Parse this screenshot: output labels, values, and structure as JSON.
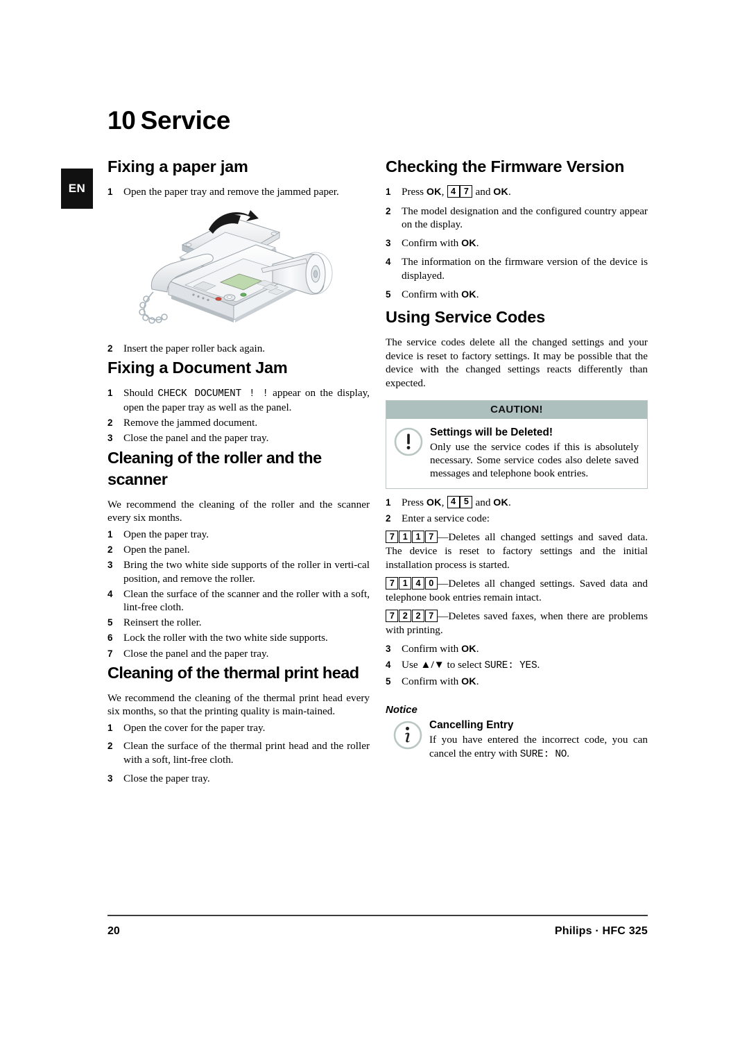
{
  "chapter": {
    "number": "10",
    "title": "Service"
  },
  "language_tab": "EN",
  "left_column": {
    "section1": {
      "heading": "Fixing a paper jam",
      "steps": [
        "Open the paper tray and remove the jammed paper.",
        "Insert the paper roller back again."
      ],
      "illustration_alt": "fax-machine-paper-tray-open"
    },
    "section2": {
      "heading": "Fixing a Document Jam",
      "step1_prefix": "Should ",
      "step1_code": "CHECK DOCUMENT ! !",
      "step1_suffix": " appear on the display, open the paper tray as well as the panel.",
      "step2": "Remove the jammed document.",
      "step3": "Close the panel and the paper tray."
    },
    "section3": {
      "heading": "Cleaning of the roller and the scanner",
      "intro": "We recommend the cleaning of the roller and the scanner every six months.",
      "steps": [
        "Open the paper tray.",
        "Open the panel.",
        "Bring the two white side supports of the roller in verti-cal position, and remove the roller.",
        "Clean the surface of the scanner and the roller with a soft, lint-free cloth.",
        "Reinsert the roller.",
        "Lock the roller with the two white side supports.",
        "Close the panel and the paper tray."
      ]
    },
    "section4": {
      "heading": "Cleaning of the thermal print head",
      "intro": "We recommend the cleaning of the thermal print head every six months, so that the printing quality is main-tained.",
      "steps": [
        "Open the cover for the paper tray.",
        "Clean the surface of the thermal print head and the roller with a soft, lint-free cloth.",
        "Close the paper tray."
      ]
    }
  },
  "right_column": {
    "section1": {
      "heading": "Checking the Firmware Version",
      "step1": {
        "prefix": "Press ",
        "ok1": "OK",
        "comma": ", ",
        "key_a": "4",
        "key_b": "7",
        "mid": " and ",
        "ok2": "OK",
        "end": "."
      },
      "step2": "The model designation and the configured country appear on the display.",
      "step3": {
        "prefix": "Confirm with ",
        "ok": "OK",
        "end": "."
      },
      "step4": "The information on the firmware version of the device is displayed.",
      "step5": {
        "prefix": "Confirm with ",
        "ok": "OK",
        "end": "."
      }
    },
    "section2": {
      "heading": "Using Service Codes",
      "intro": "The service codes delete all the changed settings and your device is reset to factory settings. It may be possible that the device with the changed settings reacts differently than expected.",
      "caution": {
        "header": "CAUTION!",
        "icon": "exclamation-circle-icon",
        "title": "Settings will be Deleted!",
        "text": "Only use the service codes if this is absolutely necessary. Some service codes also delete saved messages and telephone book entries."
      },
      "step1": {
        "prefix": "Press ",
        "ok1": "OK",
        "comma": ", ",
        "key_a": "4",
        "key_b": "5",
        "mid": " and ",
        "ok2": "OK",
        "end": "."
      },
      "step2": "Enter a service code:",
      "codes": [
        {
          "keys": [
            "7",
            "1",
            "1",
            "7"
          ],
          "description": "—Deletes all changed settings and saved data. The device is reset to factory settings and the initial installation process is started."
        },
        {
          "keys": [
            "7",
            "1",
            "4",
            "0"
          ],
          "description": "—Deletes all changed settings. Saved data and telephone book entries remain intact."
        },
        {
          "keys": [
            "7",
            "2",
            "2",
            "7"
          ],
          "description": "—Deletes saved faxes, when there are problems with printing."
        }
      ],
      "step3": {
        "prefix": "Confirm with ",
        "ok": "OK",
        "end": "."
      },
      "step4": {
        "prefix": "Use ",
        "arrows": "▲/▼",
        "mid": " to select ",
        "code": "SURE: YES",
        "end": "."
      },
      "step5": {
        "prefix": "Confirm with ",
        "ok": "OK",
        "end": "."
      },
      "notice": {
        "label": "Notice",
        "icon": "info-circle-icon",
        "title": "Cancelling Entry",
        "text_prefix": "If you have entered the incorrect code, you can cancel the entry with ",
        "text_code": "SURE: NO",
        "text_suffix": "."
      }
    }
  },
  "footer": {
    "page_number": "20",
    "brand": "Philips · HFC 325"
  },
  "colors": {
    "caution_header_bg": "#aec0be",
    "lang_tab_bg": "#111111",
    "icon_ring": "#b9c6c4",
    "footer_rule": "#3b3b3b"
  }
}
